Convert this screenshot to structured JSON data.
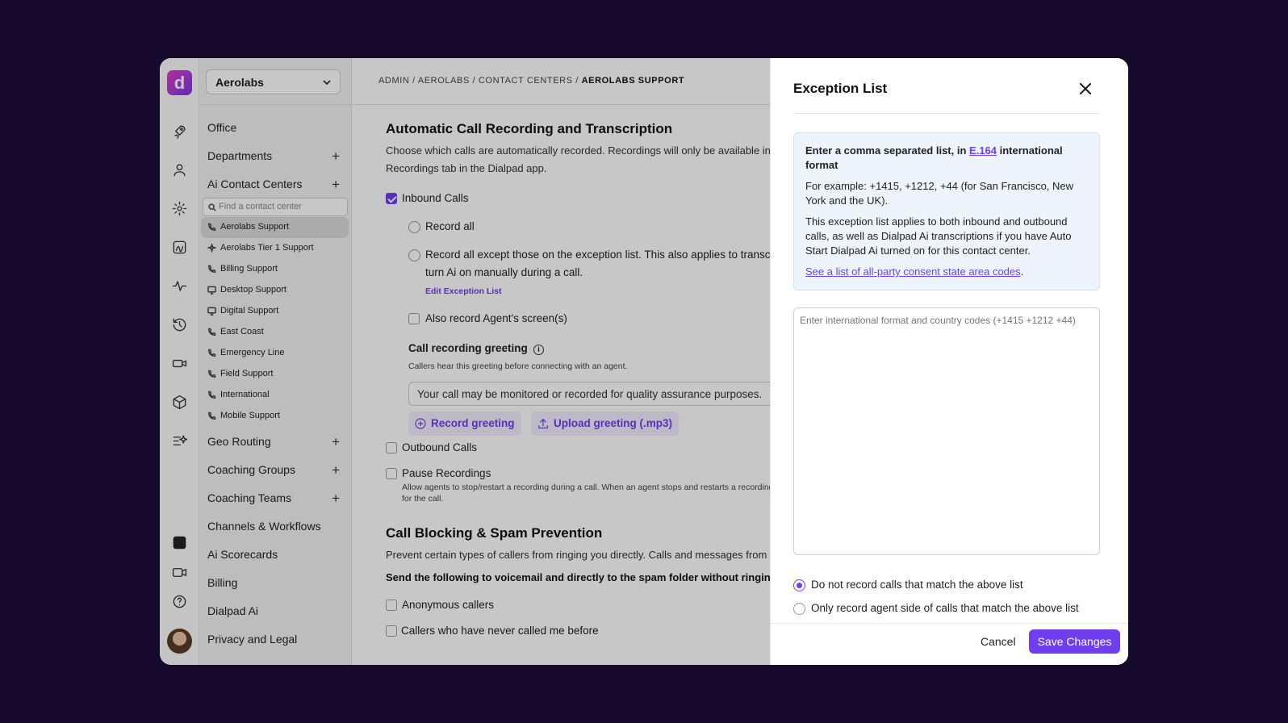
{
  "org_selector": {
    "value": "Aerolabs"
  },
  "nav": {
    "office": "Office",
    "departments": "Departments",
    "ai_contact_centers": "Ai Contact Centers",
    "search_placeholder": "Find a contact center",
    "contact_centers": [
      {
        "label": "Aerolabs Support",
        "icon": "phone-icon",
        "active": true
      },
      {
        "label": "Aerolabs Tier 1 Support",
        "icon": "sparkle-icon"
      },
      {
        "label": "Billing Support",
        "icon": "phone-icon"
      },
      {
        "label": "Desktop Support",
        "icon": "monitor-icon"
      },
      {
        "label": "Digital Support",
        "icon": "monitor-icon"
      },
      {
        "label": "East Coast",
        "icon": "phone-icon"
      },
      {
        "label": "Emergency Line",
        "icon": "phone-icon"
      },
      {
        "label": "Field Support",
        "icon": "phone-icon"
      },
      {
        "label": "International",
        "icon": "phone-icon"
      },
      {
        "label": "Mobile Support",
        "icon": "phone-icon"
      }
    ],
    "geo_routing": "Geo Routing",
    "coaching_groups": "Coaching Groups",
    "coaching_teams": "Coaching Teams",
    "channels_workflows": "Channels & Workflows",
    "ai_scorecards": "Ai Scorecards",
    "billing": "Billing",
    "dialpad_ai": "Dialpad Ai",
    "privacy_legal": "Privacy and Legal",
    "plus": "+"
  },
  "breadcrumb": {
    "path": "ADMIN / AEROLABS / CONTACT CENTERS / ",
    "current": "AEROLABS SUPPORT"
  },
  "main": {
    "recording_title": "Automatic Call Recording and Transcription",
    "recording_desc_1": "Choose which calls are automatically recorded. Recordings will only be available in the",
    "recording_desc_2": "Recordings tab in the Dialpad app.",
    "inbound_calls": "Inbound Calls",
    "record_all": "Record all",
    "record_except_1": "Record all except those on the exception list. This also applies to transcriptions if you",
    "record_except_2": "turn Ai on manually during a call.",
    "edit_exception_list": "Edit Exception List",
    "record_screens": "Also record Agent's screen(s)",
    "greeting_title": "Call recording greeting",
    "greeting_info_glyph": "i",
    "greeting_desc": "Callers hear this greeting before connecting with an agent.",
    "greeting_value": "Your call may be monitored or recorded for quality assurance purposes.",
    "record_greeting": "Record greeting",
    "upload_greeting": "Upload greeting (.mp3)",
    "outbound_calls": "Outbound Calls",
    "pause_recordings": "Pause Recordings",
    "pause_desc_1": "Allow agents to stop/restart a recording during a call. When an agent stops and restarts a recording",
    "pause_desc_2": "for the call.",
    "blocking_title": "Call Blocking & Spam Prevention",
    "blocking_desc": "Prevent certain types of callers from ringing you directly. Calls and messages from these callers",
    "blocking_bold": "Send the following to voicemail and directly to the spam folder without ringing",
    "anonymous_callers": "Anonymous callers",
    "never_called": "Callers who have never called me before"
  },
  "panel": {
    "title": "Exception List",
    "info_intro": "Enter a comma separated list, in ",
    "info_link": "E.164",
    "info_tail": " international format",
    "example": "For example: +1415, +1212, +44 (for San Francisco, New York and the UK).",
    "applies": "This exception list applies to both inbound and outbound calls, as well as Dialpad Ai transcriptions if you have Auto Start Dialpad Ai turned on for this contact center.",
    "consent_link": "See a list of all-party consent state area codes",
    "consent_period": ".",
    "textarea_placeholder": "Enter international format and country codes (+1415 +1212 +44)",
    "option_do_not_record": "Do not record calls that match the above list",
    "option_agent_side": "Only record agent side of calls that match the above list",
    "cancel": "Cancel",
    "save": "Save Changes"
  },
  "colors": {
    "accent": "#6f3ef1",
    "background": "#150a2e"
  }
}
